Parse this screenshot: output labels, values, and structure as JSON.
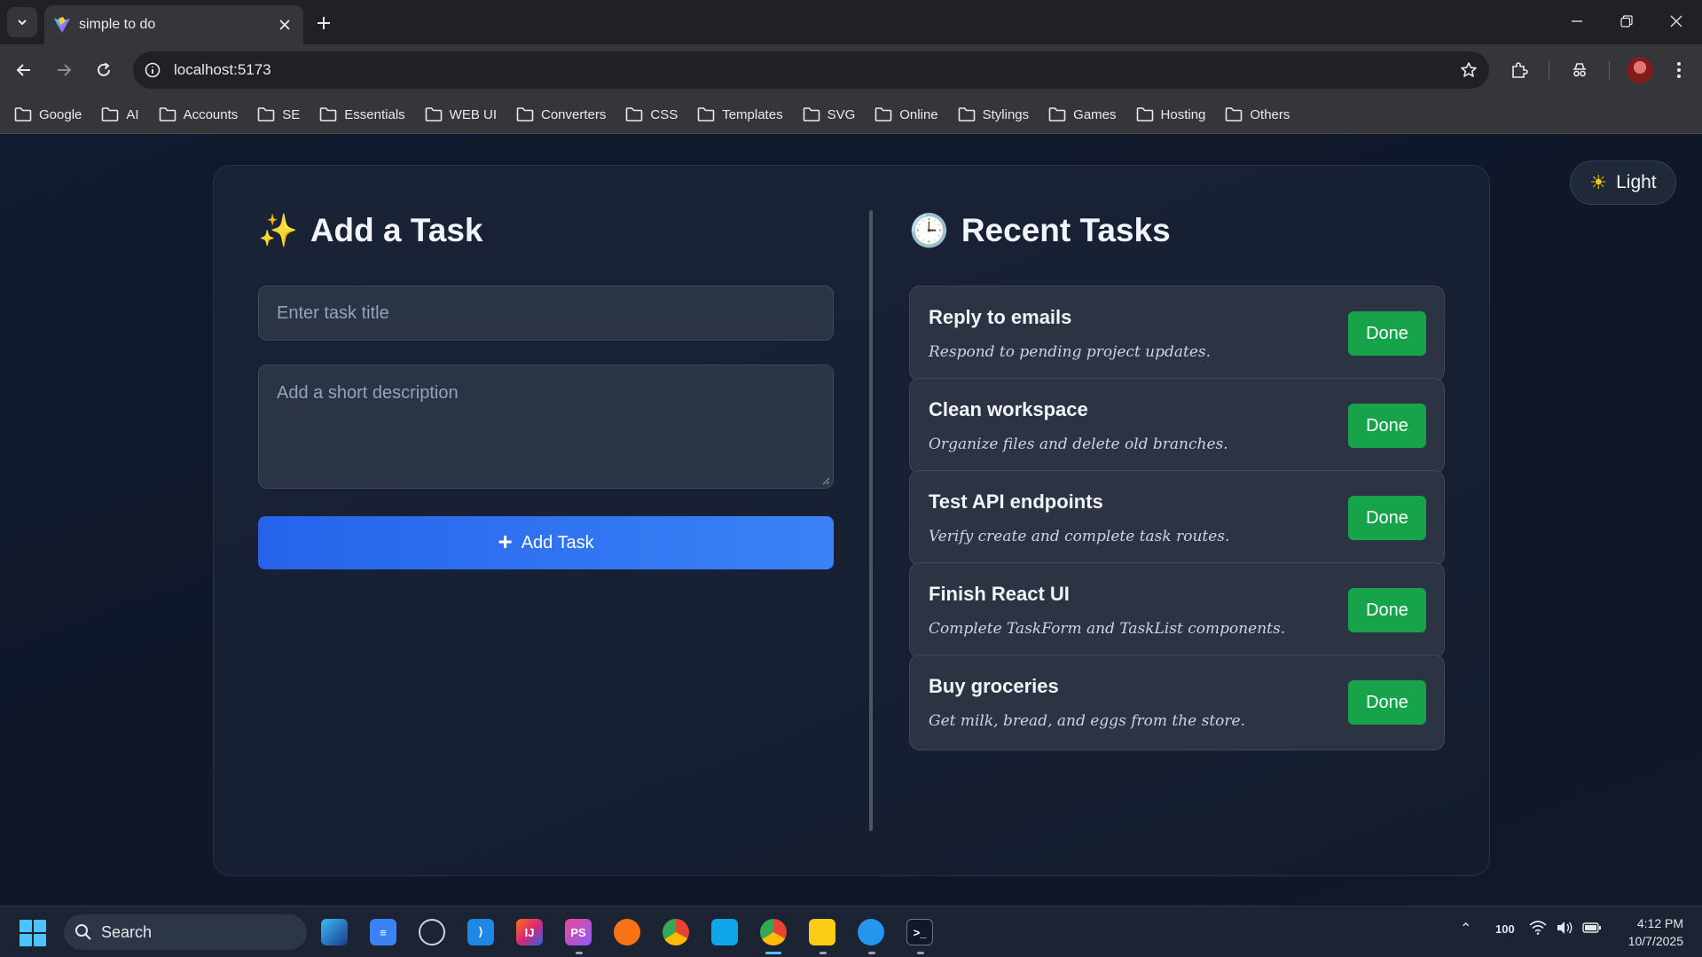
{
  "browser": {
    "tab_title": "simple to do",
    "url": "localhost:5173",
    "bookmarks": [
      "Google",
      "AI",
      "Accounts",
      "SE",
      "Essentials",
      "WEB UI",
      "Converters",
      "CSS",
      "Templates",
      "SVG",
      "Online",
      "Stylings",
      "Games",
      "Hosting",
      "Others"
    ]
  },
  "theme_toggle": {
    "label": "Light",
    "icon": "sun-icon"
  },
  "add_section": {
    "title": "Add a Task",
    "icon": "sparkles-icon",
    "title_placeholder": "Enter task title",
    "description_placeholder": "Add a short description",
    "button_label": "Add Task"
  },
  "recent_section": {
    "title": "Recent Tasks",
    "icon": "clock-icon",
    "tasks": [
      {
        "title": "Reply to emails",
        "description": "Respond to pending project updates.",
        "action": "Done"
      },
      {
        "title": "Clean workspace",
        "description": "Organize files and delete old branches.",
        "action": "Done"
      },
      {
        "title": "Test API endpoints",
        "description": "Verify create and complete task routes.",
        "action": "Done"
      },
      {
        "title": "Finish React UI",
        "description": "Complete TaskForm and TaskList components.",
        "action": "Done"
      },
      {
        "title": "Buy groceries",
        "description": "Get milk, bread, and eggs from the store.",
        "action": "Done"
      }
    ]
  },
  "taskbar": {
    "search_label": "Search",
    "tray_value": "100",
    "time": "4:12 PM",
    "date": "10/7/2025"
  },
  "colors": {
    "primary": "#2563eb",
    "success": "#16a34a",
    "background": "#0f172a"
  }
}
